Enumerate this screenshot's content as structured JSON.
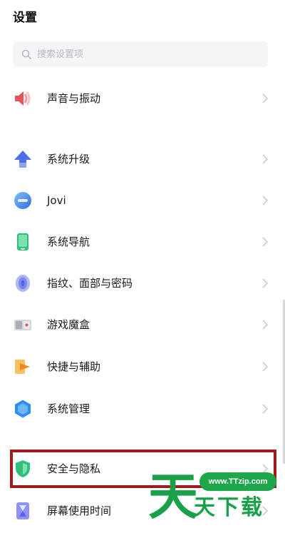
{
  "header": {
    "title": "设置"
  },
  "search": {
    "placeholder": "搜索设置项",
    "value": ""
  },
  "settings_items": [
    {
      "label": "声音与振动",
      "icon": "speaker-icon",
      "color": "#e0565b"
    },
    {
      "label": "系统升级",
      "icon": "upgrade-arrow-icon",
      "color": "#4f6fe8"
    },
    {
      "label": "Jovi",
      "icon": "jovi-icon",
      "color": "#2f7df0"
    },
    {
      "label": "系统导航",
      "icon": "phone-navigation-icon",
      "color": "#2fc07a"
    },
    {
      "label": "指纹、面部与密码",
      "icon": "fingerprint-icon",
      "color": "#6b78e8"
    },
    {
      "label": "游戏魔盒",
      "icon": "game-box-icon",
      "color": "#9aa0a8"
    },
    {
      "label": "快捷与辅助",
      "icon": "shortcut-arrow-icon",
      "color": "#f5a623"
    },
    {
      "label": "系统管理",
      "icon": "hexagon-gear-icon",
      "color": "#2e8ff0"
    },
    {
      "label": "安全与隐私",
      "icon": "shield-icon",
      "color": "#2fbf7a"
    },
    {
      "label": "屏幕使用时间",
      "icon": "hourglass-icon",
      "color": "#6a6ff0"
    }
  ],
  "highlight": {
    "target": "安全与隐私",
    "color": "#a01c1c"
  },
  "watermark": {
    "site": "www.TTzip.com",
    "glyph": "天",
    "text": "天下载",
    "color": "#19a14a"
  }
}
